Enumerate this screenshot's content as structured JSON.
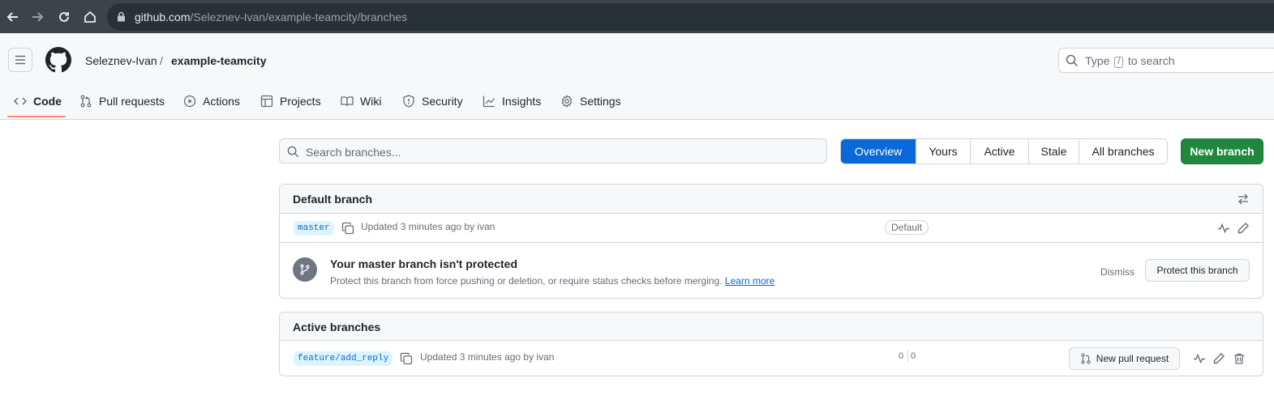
{
  "browser": {
    "url_host": "github.com",
    "url_path": "/Seleznev-Ivan/example-teamcity/branches"
  },
  "header": {
    "owner": "Seleznev-Ivan",
    "separator": "/",
    "repo": "example-teamcity",
    "search_prefix": "Type",
    "search_key": "/",
    "search_suffix": "to search"
  },
  "tabs": [
    {
      "label": "Code",
      "icon": "code-icon"
    },
    {
      "label": "Pull requests",
      "icon": "git-pull-request-icon"
    },
    {
      "label": "Actions",
      "icon": "play-icon"
    },
    {
      "label": "Projects",
      "icon": "table-icon"
    },
    {
      "label": "Wiki",
      "icon": "book-icon"
    },
    {
      "label": "Security",
      "icon": "shield-icon"
    },
    {
      "label": "Insights",
      "icon": "graph-icon"
    },
    {
      "label": "Settings",
      "icon": "gear-icon"
    }
  ],
  "branches_page": {
    "search_placeholder": "Search branches...",
    "filters": [
      "Overview",
      "Yours",
      "Active",
      "Stale",
      "All branches"
    ],
    "active_filter": "Overview",
    "new_branch_label": "New branch"
  },
  "default_branch": {
    "heading": "Default branch",
    "name": "master",
    "updated": "Updated 3 minutes ago by ivan",
    "badge": "Default",
    "protection": {
      "title": "Your master branch isn't protected",
      "description": "Protect this branch from force pushing or deletion, or require status checks before merging.",
      "link": "Learn more",
      "dismiss_label": "Dismiss",
      "protect_label": "Protect this branch"
    }
  },
  "active_branches": {
    "heading": "Active branches",
    "items": [
      {
        "name": "feature/add_reply",
        "updated": "Updated 3 minutes ago by ivan",
        "behind": "0",
        "ahead": "0",
        "pr_label": "New pull request"
      }
    ]
  },
  "colors": {
    "accent": "#0969da",
    "primary_button": "#1f883d",
    "tab_underline": "#fd8c73"
  }
}
